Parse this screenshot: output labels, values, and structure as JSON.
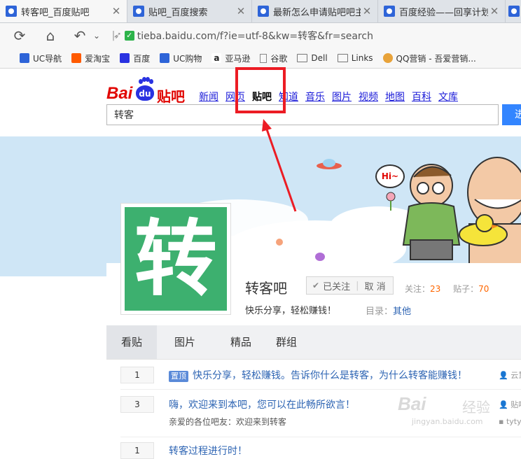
{
  "browser": {
    "tabs": [
      {
        "title": "转客吧_百度贴吧",
        "active": true
      },
      {
        "title": "贴吧_百度搜索",
        "active": false
      },
      {
        "title": "最新怎么申请贴吧吧主",
        "active": false
      },
      {
        "title": "百度经验——回享计划",
        "active": false
      }
    ],
    "url": "tieba.baidu.com/f?ie=utf-8&kw=转客&fr=search",
    "bookmarks": [
      {
        "label": "UC导航",
        "icon": "uc-nav-icon",
        "color": "#2e64d8"
      },
      {
        "label": "爱淘宝",
        "icon": "taobao-icon",
        "color": "#ff5a00"
      },
      {
        "label": "百度",
        "icon": "baidu-paw-icon",
        "color": "#2932e1"
      },
      {
        "label": "UC购物",
        "icon": "uc-shop-icon",
        "color": "#2e64d8"
      },
      {
        "label": "亚马逊",
        "icon": "amazon-icon",
        "color": "#222222"
      },
      {
        "label": "谷歌",
        "icon": "page-icon",
        "color": "#888888"
      },
      {
        "label": "Dell",
        "icon": "folder-icon",
        "color": "#888888"
      },
      {
        "label": "Links",
        "icon": "folder-icon",
        "color": "#888888"
      },
      {
        "label": "QQ营销 - 吾爱营销...",
        "icon": "qq-icon",
        "color": "#e8a33a"
      }
    ]
  },
  "header": {
    "logo": {
      "bai": "Bai",
      "du": "du",
      "tieba": "贴吧"
    },
    "nav": [
      {
        "label": "新闻",
        "current": false
      },
      {
        "label": "网页",
        "current": false
      },
      {
        "label": "贴吧",
        "current": true
      },
      {
        "label": "知道",
        "current": false
      },
      {
        "label": "音乐",
        "current": false
      },
      {
        "label": "图片",
        "current": false
      },
      {
        "label": "视频",
        "current": false
      },
      {
        "label": "地图",
        "current": false
      },
      {
        "label": "百科",
        "current": false
      },
      {
        "label": "文库",
        "current": false
      }
    ],
    "search_value": "转客",
    "search_button": "进"
  },
  "banner": {
    "hi_text": "Hi~"
  },
  "forum": {
    "avatar_char": "转",
    "name": "转客吧",
    "follow_check": "✔",
    "follow_label": "已关注",
    "unfollow_label": "取 消",
    "followers_label": "关注：",
    "followers": "23",
    "posts_label": "贴子：",
    "posts": "70",
    "slogan": "快乐分享，轻松赚钱！",
    "catalog_label": "目录：",
    "catalog_value": "其他"
  },
  "tabs": [
    "看贴",
    "图片",
    "精品",
    "群组"
  ],
  "threads": [
    {
      "replies": "1",
      "pin_label": "置顶",
      "title": "快乐分享，轻松赚钱。告诉你什么是转客，为什么转客能赚钱！",
      "author": "云慧"
    },
    {
      "replies": "3",
      "title": "嗨，欢迎来到本吧，您可以在此畅所欲言！",
      "excerpt": "亲爱的各位吧友：欢迎来到转客",
      "author": "贴吧",
      "last": "tyty"
    },
    {
      "replies": "1",
      "title": "转客过程进行时！"
    }
  ],
  "watermark": {
    "brand": "Bai",
    "brand2": "经验",
    "site": "jingyan.baidu.com"
  },
  "colors": {
    "accent_red": "#ec1c24",
    "link_blue": "#2d64b3",
    "forum_green": "#3db06f",
    "search_blue": "#3385ff"
  }
}
